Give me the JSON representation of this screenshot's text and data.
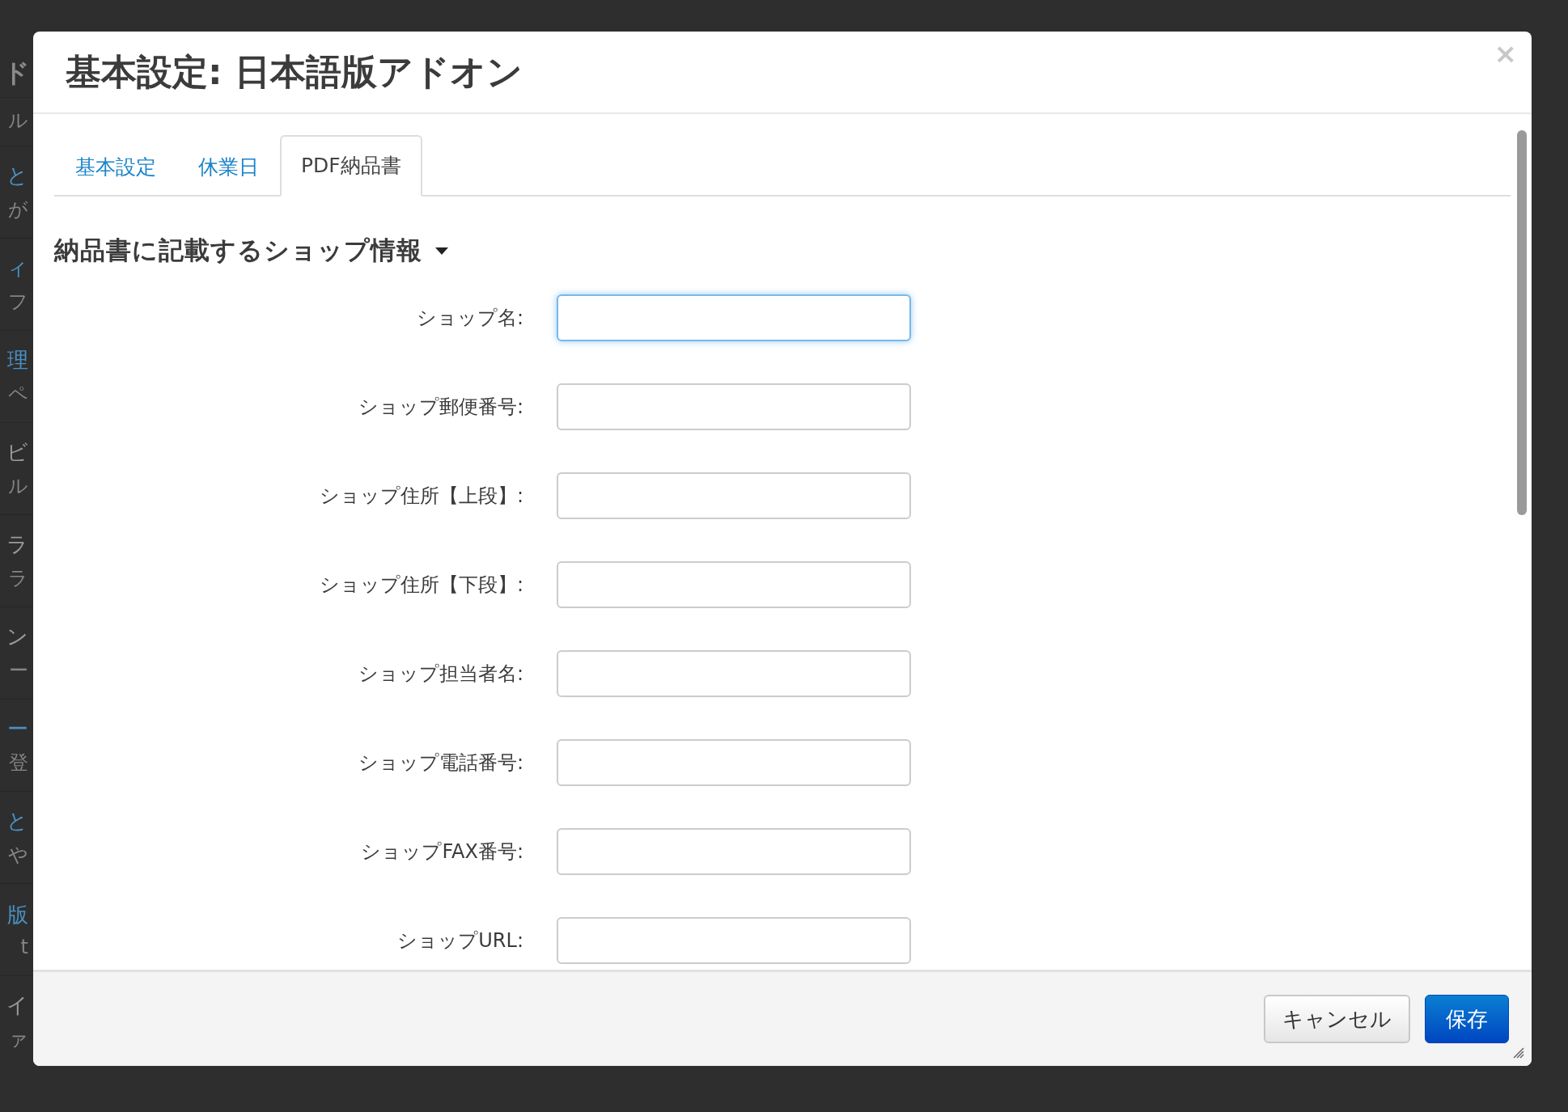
{
  "background": {
    "heading": "ド",
    "groups": [
      {
        "sub": "ル"
      },
      {
        "title": "と",
        "link": true,
        "sub": "が"
      },
      {
        "title": "ィ",
        "link": true,
        "sub": "フ"
      },
      {
        "title": "理",
        "link": true,
        "sub": "ペ"
      },
      {
        "title": "ビ",
        "link": false,
        "sub": "ル"
      },
      {
        "title": "ラ",
        "link": false,
        "sub": "ラ"
      },
      {
        "title": "ン",
        "link": false,
        "sub": "ー"
      },
      {
        "title": "ー",
        "link": true,
        "sub": "登"
      },
      {
        "title": "と",
        "link": true,
        "sub": "や"
      },
      {
        "title": "版",
        "link": true,
        "sub": "t"
      },
      {
        "title": "イ",
        "link": false,
        "sub": "ァ"
      }
    ]
  },
  "dialog": {
    "title": "基本設定: 日本語版アドオン",
    "close": "×",
    "tabs": [
      {
        "label": "基本設定",
        "selected": false
      },
      {
        "label": "休業日",
        "selected": false
      },
      {
        "label": "PDF納品書",
        "selected": true
      }
    ],
    "section": {
      "heading": "納品書に記載するショップ情報",
      "expanded": true
    },
    "fields": [
      {
        "label": "ショップ名:",
        "focused": true
      },
      {
        "label": "ショップ郵便番号:",
        "focused": false
      },
      {
        "label": "ショップ住所【上段】:",
        "focused": false
      },
      {
        "label": "ショップ住所【下段】:",
        "focused": false
      },
      {
        "label": "ショップ担当者名:",
        "focused": false
      },
      {
        "label": "ショップ電話番号:",
        "focused": false
      },
      {
        "label": "ショップFAX番号:",
        "focused": false
      },
      {
        "label": "ショップURL:",
        "focused": false
      }
    ],
    "buttons": [
      {
        "label": "キャンセル",
        "kind": "secondary"
      },
      {
        "label": "保存",
        "kind": "primary"
      }
    ]
  }
}
